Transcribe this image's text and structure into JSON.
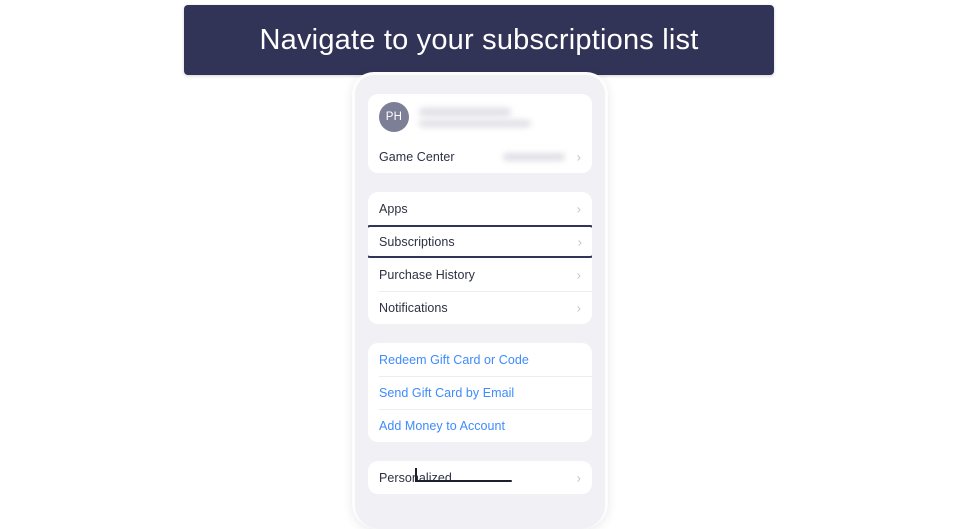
{
  "banner": {
    "text": "Navigate to your subscriptions list",
    "bg_color": "#323457",
    "text_color": "#ffffff"
  },
  "phone": {
    "screen_bg": "#f0f0f5",
    "account_card": {
      "avatar_initials": "PH",
      "avatar_color": "#7c7f95",
      "name_redacted": true,
      "email_redacted": true,
      "rows": [
        {
          "label": "Game Center",
          "value_redacted": true,
          "chevron": "chevron-right-icon"
        }
      ]
    },
    "menu_card": {
      "rows": [
        {
          "label": "Apps",
          "chevron": "chevron-right-icon",
          "highlighted": false
        },
        {
          "label": "Subscriptions",
          "chevron": "chevron-right-icon",
          "highlighted": true
        },
        {
          "label": "Purchase History",
          "chevron": "chevron-right-icon",
          "highlighted": false
        },
        {
          "label": "Notifications",
          "chevron": "chevron-right-icon",
          "highlighted": false
        }
      ],
      "highlight_color": "#323457"
    },
    "gift_card": {
      "link_color": "#3d8bfd",
      "rows": [
        {
          "label": "Redeem Gift Card or Code"
        },
        {
          "label": "Send Gift Card by Email"
        },
        {
          "label": "Add Money to Account"
        }
      ]
    },
    "personalized_card": {
      "rows": [
        {
          "label": "Personalized",
          "chevron": "chevron-right-icon",
          "annotated": true
        }
      ]
    }
  }
}
